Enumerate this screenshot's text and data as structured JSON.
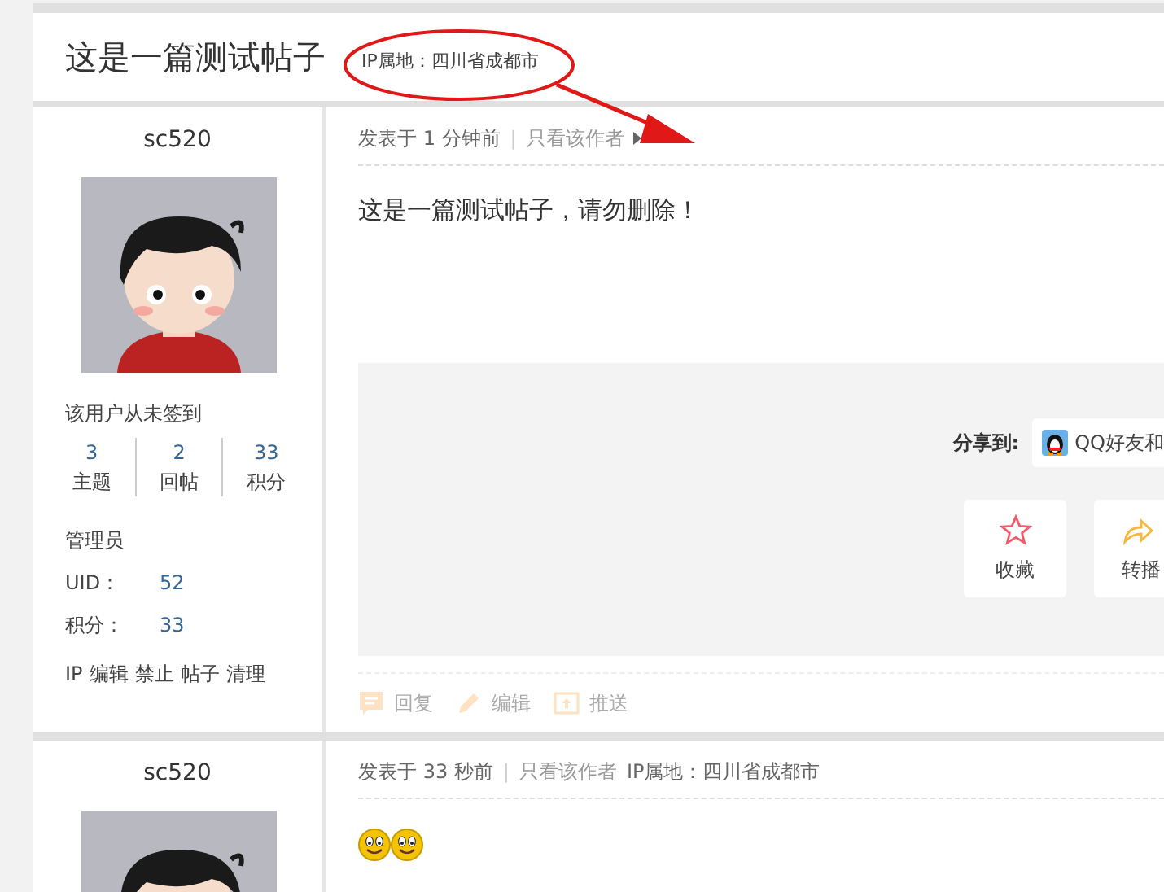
{
  "thread": {
    "title": "这是一篇测试帖子",
    "ip_location": "IP属地：四川省成都市"
  },
  "annotation": {
    "ellipse": true,
    "arrow": true
  },
  "posts": [
    {
      "author": {
        "name": "sc520",
        "sign_status": "该用户从未签到",
        "stats": [
          {
            "value": "3",
            "label": "主题"
          },
          {
            "value": "2",
            "label": "回帖"
          },
          {
            "value": "33",
            "label": "积分"
          }
        ],
        "group": "管理员",
        "fields": [
          {
            "label": "UID：",
            "value": "52"
          },
          {
            "label": "积分：",
            "value": "33"
          }
        ],
        "admin_links": [
          "IP",
          "编辑",
          "禁止",
          "帖子",
          "清理"
        ]
      },
      "meta": {
        "posted": "发表于 1 分钟前",
        "separator": "|",
        "only_author": "只看该作者"
      },
      "content": [
        {
          "kind": "text",
          "text": "这是一篇测试帖子，请勿删除！"
        }
      ],
      "share": {
        "label": "分享到:",
        "target": "QQ好友和"
      },
      "actions": [
        {
          "kind": "favorite",
          "label": "收藏"
        },
        {
          "kind": "repost",
          "label": "转播"
        }
      ],
      "footer": {
        "faded": true,
        "items": [
          {
            "kind": "reply",
            "label": "回复"
          },
          {
            "kind": "edit",
            "label": "编辑"
          },
          {
            "kind": "push",
            "label": "推送"
          }
        ]
      }
    },
    {
      "author": {
        "name": "sc520"
      },
      "meta": {
        "posted": "发表于 33 秒前",
        "separator": "|",
        "only_author": "只看该作者",
        "ip_location": "IP属地：四川省成都市"
      },
      "content": [
        {
          "kind": "smiley"
        },
        {
          "kind": "smiley"
        }
      ]
    }
  ]
}
